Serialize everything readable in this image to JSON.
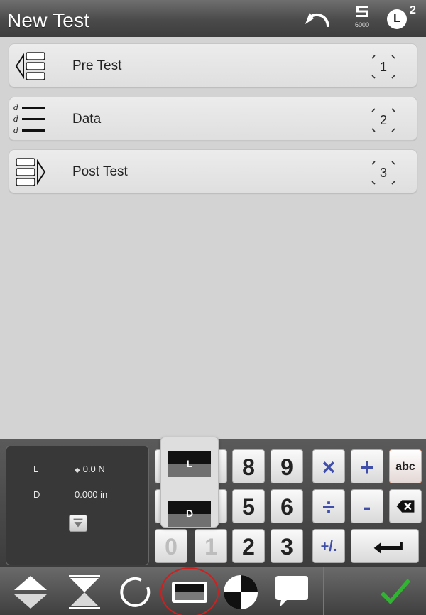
{
  "header": {
    "title": "New Test",
    "station_number": "6000",
    "load_channel": "L",
    "load_superscript": "2"
  },
  "rows": [
    {
      "label": "Pre Test",
      "number": "1",
      "icon": "pre-test-icon"
    },
    {
      "label": "Data",
      "number": "2",
      "icon": "data-list-icon"
    },
    {
      "label": "Post Test",
      "number": "3",
      "icon": "post-test-icon"
    }
  ],
  "readout": {
    "load_label": "L",
    "load_value": "0.0 N",
    "disp_label": "D",
    "disp_value": "0.000 in"
  },
  "keypad": {
    "k8": "8",
    "k9": "9",
    "times": "×",
    "plus": "+",
    "abc": "abc",
    "k5": "5",
    "k6": "6",
    "divide": "÷",
    "minus": "-",
    "k2": "2",
    "k3": "3",
    "plusminus": "+/.",
    "hidden_left_bottom": "0",
    "hidden_mid_bottom": "1"
  },
  "channel_selector": {
    "top_channel": "L",
    "bottom_channel": "D"
  },
  "colors": {
    "accent_red": "#d01f1f",
    "confirm_green": "#2fb52f",
    "operator_blue": "#3f4ea8"
  }
}
